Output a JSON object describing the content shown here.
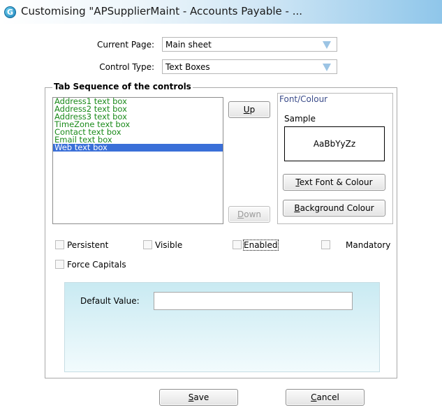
{
  "window": {
    "title": "Customising \"APSupplierMaint - Accounts Payable - ...",
    "icon": "app-logo-icon",
    "icon_letter": "G"
  },
  "current_page": {
    "label": "Current Page:",
    "value": "Main sheet"
  },
  "control_type": {
    "label": "Control Type:",
    "value": "Text Boxes"
  },
  "tab_sequence": {
    "title": "Tab Sequence of the controls",
    "items": [
      "Address1 text box",
      "Address2 text box",
      "Address3 text box",
      "TimeZone text box",
      "Contact text box",
      "Email text box",
      "Web text box"
    ],
    "selected_index": 6,
    "up_button": {
      "mnemonic": "U",
      "rest": "p"
    },
    "down_button": {
      "mnemonic": "D",
      "rest": "own"
    }
  },
  "font_colour": {
    "title": "Font/Colour",
    "sample_label": "Sample",
    "sample_text": "AaBbYyZz",
    "text_font_button": {
      "mnemonic": "T",
      "rest": "ext Font & Colour"
    },
    "background_button": {
      "mnemonic": "B",
      "rest": "ackground Colour"
    }
  },
  "checkboxes": {
    "persistent": {
      "label": "Persistent",
      "checked": false
    },
    "visible": {
      "label": "Visible",
      "checked": false
    },
    "enabled": {
      "label": "Enabled",
      "checked": false
    },
    "mandatory": {
      "label": "Mandatory",
      "checked": false
    },
    "force_capitals": {
      "label": "Force Capitals",
      "checked": false
    }
  },
  "default_value": {
    "label": "Default Value:",
    "value": ""
  },
  "save_button": {
    "mnemonic": "S",
    "rest": "ave"
  },
  "cancel_button": {
    "mnemonic": "C",
    "rest": "ancel"
  },
  "colors": {
    "list_text": "#1a8a1a",
    "selection": "#3a6fd8",
    "combo_arrow": "#9cc4e4",
    "panel_gradient_top": "#c9eaf2"
  }
}
